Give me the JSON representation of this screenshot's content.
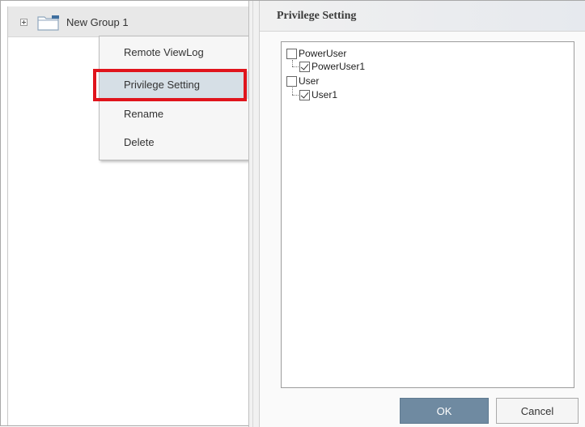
{
  "tree": {
    "group_label": "New Group 1",
    "expander_icon": "plus-expander-icon",
    "folder_icon": "folder-icon"
  },
  "context_menu": {
    "items": [
      {
        "label": "Remote ViewLog"
      },
      {
        "label": "Privilege Setting"
      },
      {
        "label": "Rename"
      },
      {
        "label": "Delete"
      }
    ],
    "highlight_color": "#e0141c"
  },
  "privilege_panel": {
    "title": "Privilege Setting",
    "nodes": [
      {
        "label": "PowerUser",
        "checked": false
      },
      {
        "label": "PowerUser1",
        "checked": true
      },
      {
        "label": "User",
        "checked": false
      },
      {
        "label": "User1",
        "checked": true
      }
    ],
    "ok_label": "OK",
    "cancel_label": "Cancel",
    "ok_color": "#6f8aa1"
  }
}
